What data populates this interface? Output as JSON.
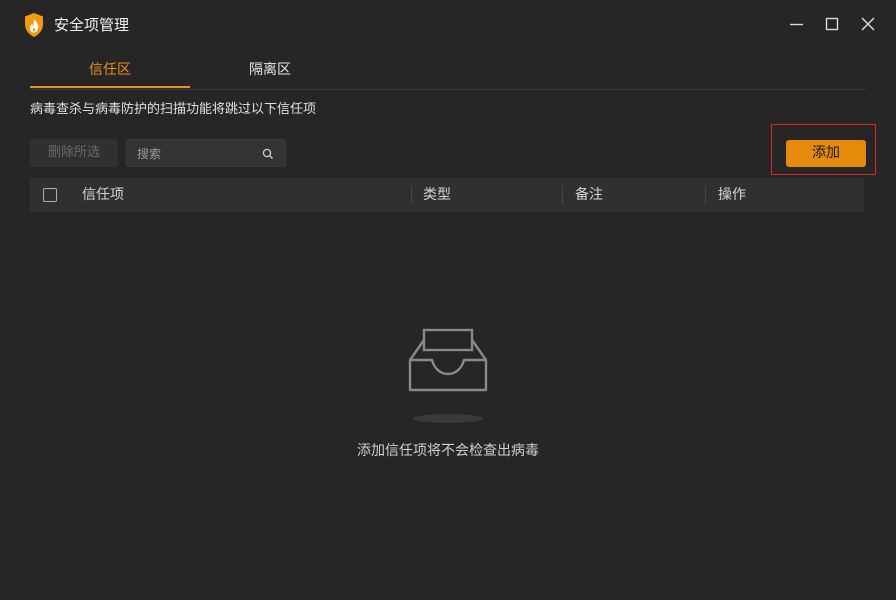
{
  "window": {
    "title": "安全项管理",
    "icon": "shield-flame-icon",
    "controls": [
      "minimize-icon",
      "maximize-icon",
      "close-icon"
    ]
  },
  "tabs": [
    {
      "label": "信任区",
      "active": true
    },
    {
      "label": "隔离区",
      "active": false
    }
  ],
  "description": "病毒查杀与病毒防护的扫描功能将跳过以下信任项",
  "toolbar": {
    "delete_label": "删除所选",
    "search_placeholder": "搜索",
    "add_label": "添加"
  },
  "table": {
    "columns": [
      "信任项",
      "类型",
      "备注",
      "操作"
    ],
    "rows": []
  },
  "empty_state": {
    "icon": "empty-tray-icon",
    "message": "添加信任项将不会检查出病毒"
  },
  "colors": {
    "accent": "#e68a0c",
    "background": "#262626",
    "highlight": "#e0242a"
  }
}
